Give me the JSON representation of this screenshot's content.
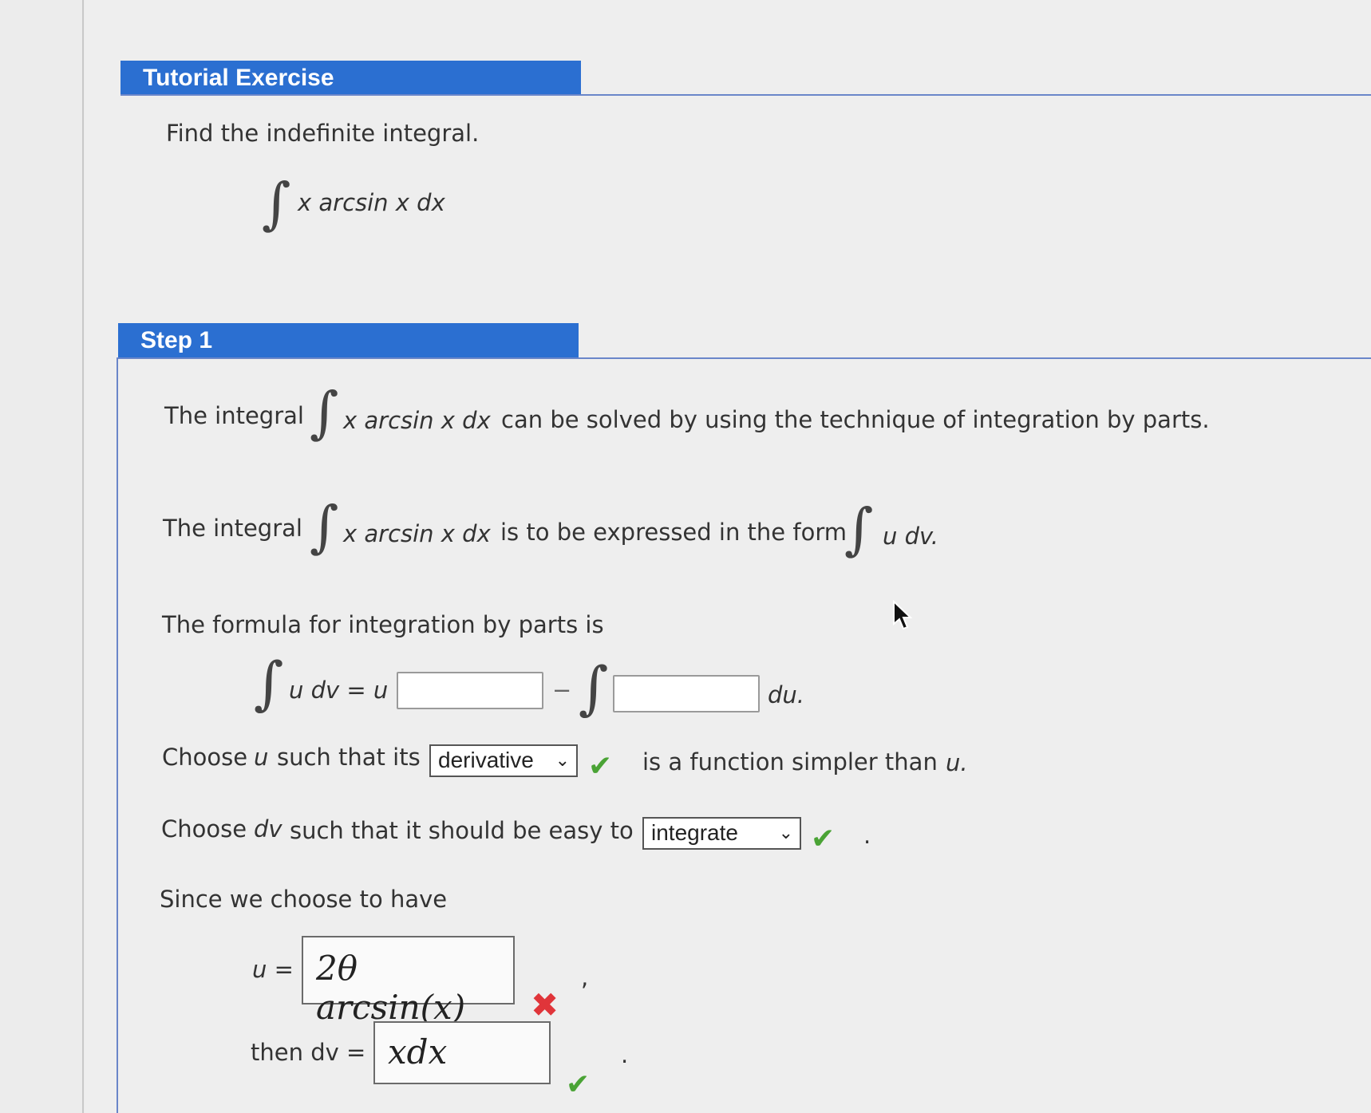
{
  "tutorial": {
    "header": "Tutorial Exercise",
    "prompt": "Find the indefinite integral.",
    "integrand": "x arcsin x dx"
  },
  "step1": {
    "header": "Step 1",
    "line1_prefix": "The integral",
    "line1_integrand": "x arcsin x dx",
    "line1_suffix": "can be solved by using the technique of integration by parts.",
    "line2_prefix": "The integral",
    "line2_integrand": "x arcsin x dx",
    "line2_mid": "is to be expressed in the form",
    "line2_form": "u dv.",
    "formula_intro": "The formula for integration by parts is",
    "formula_lhs": "u dv = u",
    "formula_minus": "−",
    "formula_du": "du.",
    "blank1_value": "",
    "blank2_value": "",
    "choose_u_prefix": "Choose",
    "choose_u_var": "u",
    "choose_u_mid": "such that its",
    "choose_u_select": "derivative",
    "choose_u_suffix": "is a function simpler than",
    "choose_u_end": "u.",
    "choose_dv_prefix": "Choose",
    "choose_dv_var": "dv",
    "choose_dv_mid": "such that it should be easy to",
    "choose_dv_select": "integrate",
    "choose_dv_end": ".",
    "since_text": "Since we choose to have",
    "u_label": "u =",
    "u_answer": "2θ arcsin(x)",
    "u_comma": ",",
    "dv_label": "then dv =",
    "dv_answer": "xdx",
    "dv_period": "."
  },
  "colors": {
    "header_blue": "#2b6fd1",
    "check_green": "#4aa335",
    "cross_red": "#e0353a"
  },
  "icons": {
    "correct": "check-icon",
    "incorrect": "cross-icon",
    "dropdown": "chevron-down-icon",
    "cursor": "cursor-arrow-icon"
  }
}
